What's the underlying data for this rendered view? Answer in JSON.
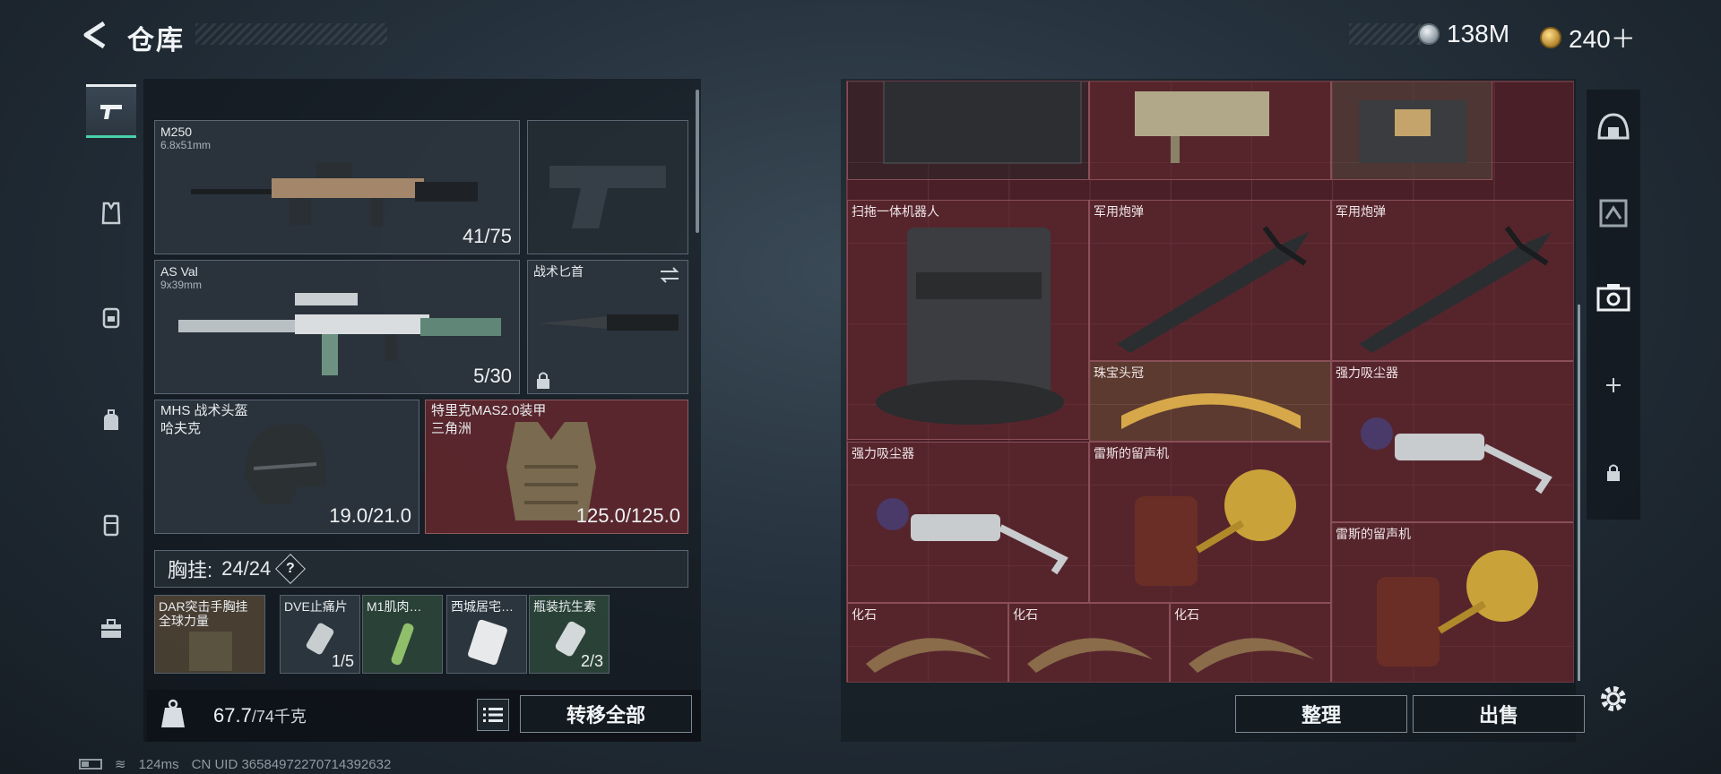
{
  "header": {
    "title": "仓库",
    "currency": [
      {
        "value": "138M",
        "icon": "silver-coin-icon"
      },
      {
        "value": "240＋",
        "icon": "gold-coin-icon"
      }
    ]
  },
  "tabs": [
    {
      "icon": "pistol-icon",
      "active": true
    },
    {
      "icon": "vest-icon",
      "active": false
    },
    {
      "icon": "backpack-icon",
      "active": false
    },
    {
      "icon": "bag-icon",
      "active": false
    },
    {
      "icon": "container-icon",
      "active": false
    },
    {
      "icon": "toolbox-icon",
      "active": false
    }
  ],
  "loadout": {
    "slots": [
      {
        "name": "M250",
        "sub": "6.8x51mm",
        "count": "41/75"
      },
      {
        "name": "",
        "sub": "",
        "count": ""
      },
      {
        "name": "AS Val",
        "sub": "9x39mm",
        "count": "5/30"
      },
      {
        "name": "战术匕首",
        "sub": "",
        "count": ""
      },
      {
        "name": "MHS 战术头盔",
        "sub": "哈夫克",
        "count": "19.0/21.0"
      },
      {
        "name": "特里克MAS2.0装甲",
        "sub": "三角洲",
        "count": "125.0/125.0"
      }
    ],
    "chest_rig": {
      "label": "胸挂:",
      "value": "24/24",
      "help": "?"
    },
    "rig_items": [
      {
        "name": "DAR突击手胸挂",
        "sub": "全球力量",
        "count": ""
      },
      {
        "name": "DVE止痛片",
        "count": "1/5"
      },
      {
        "name": "M1肌肉…",
        "count": ""
      },
      {
        "name": "西城居宅…",
        "count": ""
      },
      {
        "name": "瓶装抗生素",
        "count": "2/3"
      }
    ],
    "weight": {
      "value": "67.7",
      "max": "/74千克"
    },
    "transfer_all": "转移全部"
  },
  "stash": {
    "items": [
      {
        "label": ""
      },
      {
        "label": ""
      },
      {
        "label": ""
      },
      {
        "label": "扫拖一体机器人"
      },
      {
        "label": "军用炮弹"
      },
      {
        "label": "军用炮弹"
      },
      {
        "label": "珠宝头冠"
      },
      {
        "label": "强力吸尘器"
      },
      {
        "label": "强力吸尘器"
      },
      {
        "label": "雷斯的留声机"
      },
      {
        "label": "雷斯的留声机"
      },
      {
        "label": "化石"
      },
      {
        "label": "化石"
      },
      {
        "label": "化石"
      }
    ],
    "sort_button": "整理",
    "sell_button": "出售"
  },
  "side_icons": [
    "helmet-icon",
    "armor-icon",
    "camera-icon",
    "plus-icon",
    "lock-icon"
  ],
  "status_bar": {
    "ping": "124ms",
    "uid": "CN UID 36584972270714392632"
  },
  "colors": {
    "stash_bg": "#4a1f27",
    "accent": "#4ad0a8",
    "panel": "#2c353e"
  }
}
